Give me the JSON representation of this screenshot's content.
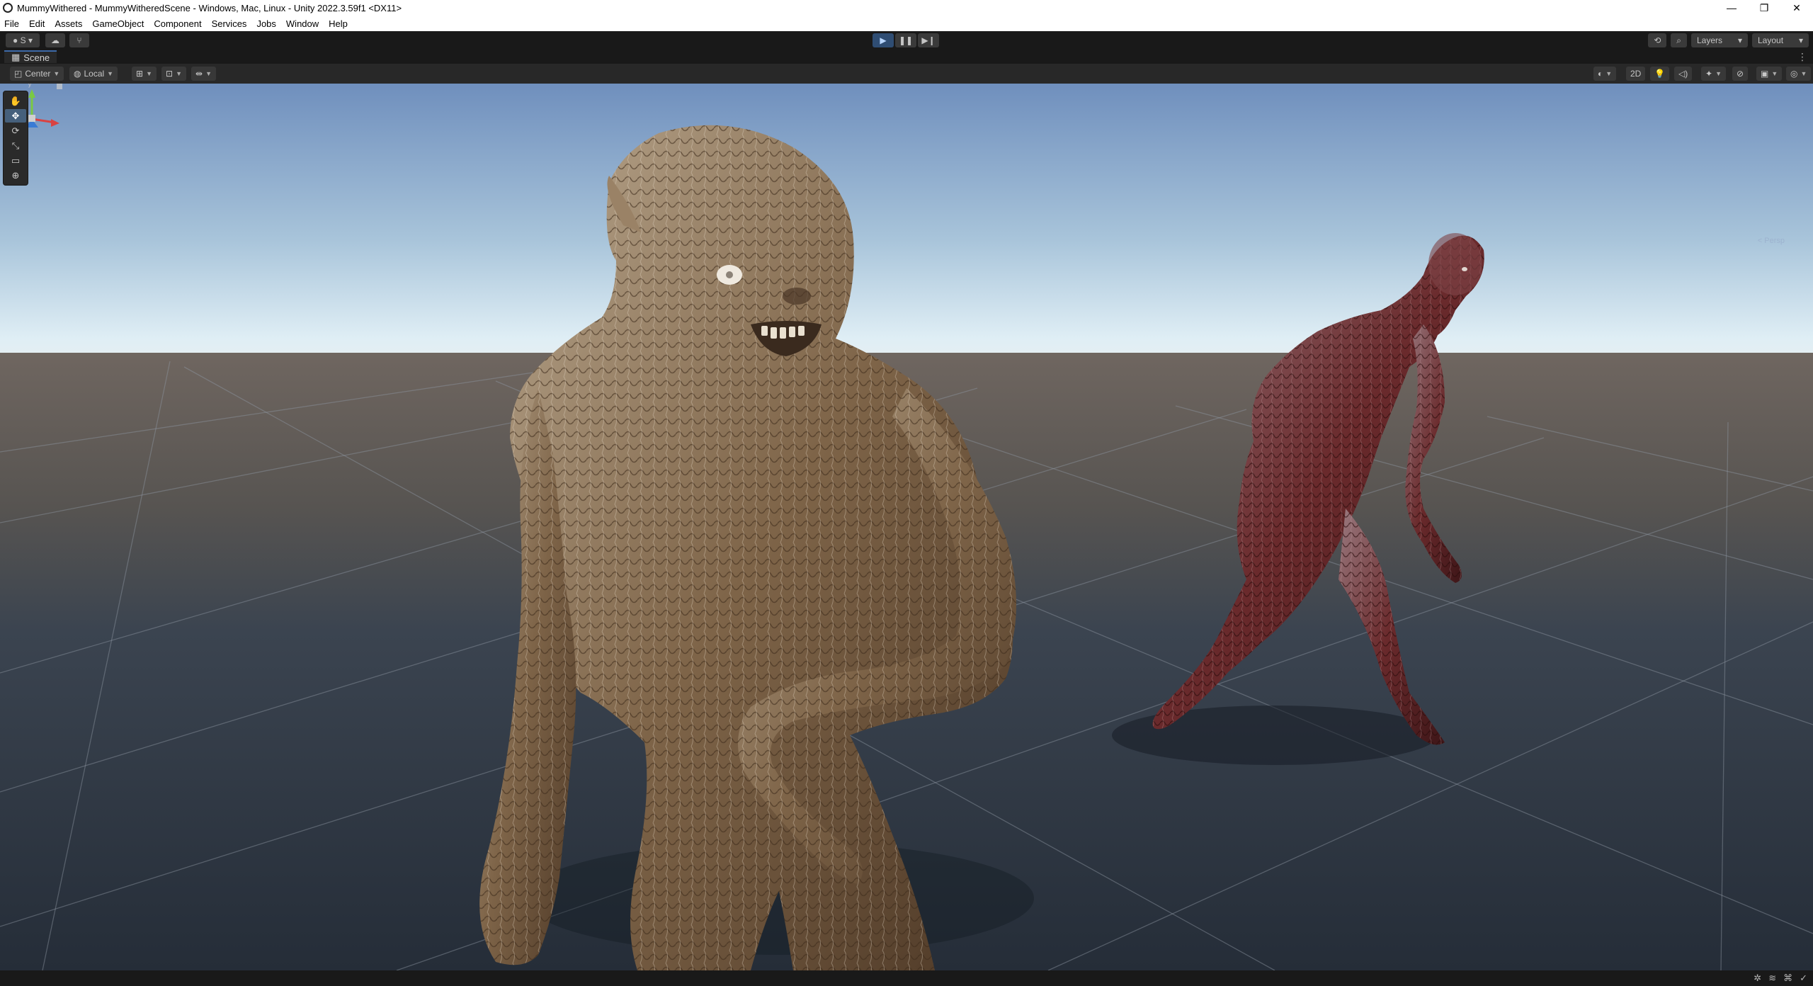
{
  "window": {
    "title": "MummyWithered - MummyWitheredScene - Windows, Mac, Linux - Unity 2022.3.59f1 <DX11>",
    "controls": [
      "—",
      "❐",
      "✕"
    ]
  },
  "menu": {
    "items": [
      "File",
      "Edit",
      "Assets",
      "GameObject",
      "Component",
      "Services",
      "Jobs",
      "Window",
      "Help"
    ]
  },
  "toolbar": {
    "account_label": "S",
    "layers_label": "Layers",
    "layout_label": "Layout"
  },
  "scene": {
    "tab_label": "Scene",
    "pivot_label": "Center",
    "space_label": "Local",
    "view_2d_label": "2D",
    "persp_label": "< Persp"
  },
  "tools": [
    "hand-tool",
    "move-tool",
    "rotate-tool",
    "scale-tool",
    "rect-tool",
    "transform-tool"
  ],
  "colors": {
    "accent": "#3d6aa8",
    "sky_top": "#6f8fbd",
    "horizon": "#dfeef5",
    "ground_far": "#6f6660",
    "ground_near": "#2d3744"
  }
}
